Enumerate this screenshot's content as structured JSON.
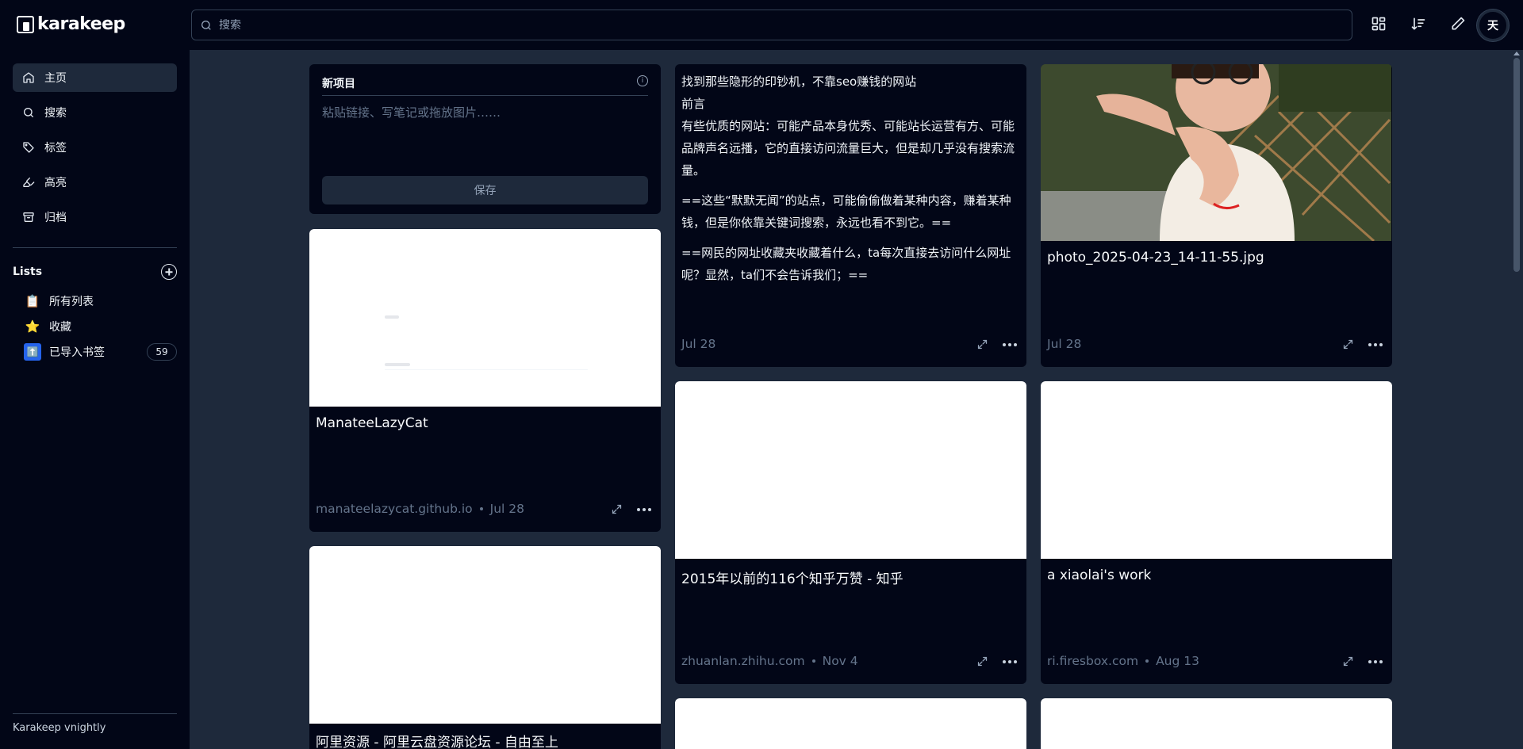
{
  "app": {
    "name": "karakeep",
    "version": "Karakeep vnightly"
  },
  "nav": [
    {
      "label": "主页",
      "icon": "home-icon",
      "active": true
    },
    {
      "label": "搜索",
      "icon": "search-icon",
      "active": false
    },
    {
      "label": "标签",
      "icon": "tag-icon",
      "active": false
    },
    {
      "label": "高亮",
      "icon": "highlighter-icon",
      "active": false
    },
    {
      "label": "归档",
      "icon": "archive-icon",
      "active": false
    }
  ],
  "lists": {
    "title": "Lists",
    "items": [
      {
        "emoji": "📋",
        "label": "所有列表",
        "count": ""
      },
      {
        "emoji": "⭐",
        "label": "收藏",
        "count": ""
      },
      {
        "emoji": "⬆️",
        "label": "已导入书签",
        "count": "59"
      }
    ]
  },
  "search": {
    "placeholder": "搜索"
  },
  "user": {
    "avatar_letter": "天"
  },
  "new_item": {
    "title": "新项目",
    "placeholder": "粘贴链接、写笔记或拖放图片……",
    "save_label": "保存"
  },
  "note_card": {
    "lines": [
      "找到那些隐形的印钞机，不靠seo赚钱的网站",
      "前言",
      "有些优质的网站：可能产品本身优秀、可能站长运营有方、可能品牌声名远播，它的直接访问流量巨大，但是却几乎没有搜索流量。",
      "==这些“默默无闻”的站点，可能偷偷做着某种内容，赚着某种钱，但是你依靠关键词搜索，永远也看不到它。==",
      "==网民的网址收藏夹收藏着什么，ta每次直接去访问什么网址呢？显然，ta们不会告诉我们；=="
    ],
    "date": "Jul 28"
  },
  "cards": {
    "manatee": {
      "title": "ManateeLazyCat",
      "source": "manateelazycat.github.io",
      "date": "Jul 28"
    },
    "photo": {
      "title": "photo_2025-04-23_14-11-55.jpg",
      "date": "Jul 28"
    },
    "zhihu": {
      "title": "2015年以前的116个知乎万赞 - 知乎",
      "source": "zhuanlan.zhihu.com",
      "date": "Nov 4"
    },
    "xiaolai": {
      "title": "a xiaolai's work",
      "source": "ri.firesbox.com",
      "date": "Aug 13"
    },
    "aliyun": {
      "title": "阿里资源 - 阿里云盘资源论坛 - 自由至上"
    }
  },
  "colors": {
    "sidebar_bg": "#020617",
    "main_bg": "#1e293b",
    "card_bg": "#020617"
  }
}
